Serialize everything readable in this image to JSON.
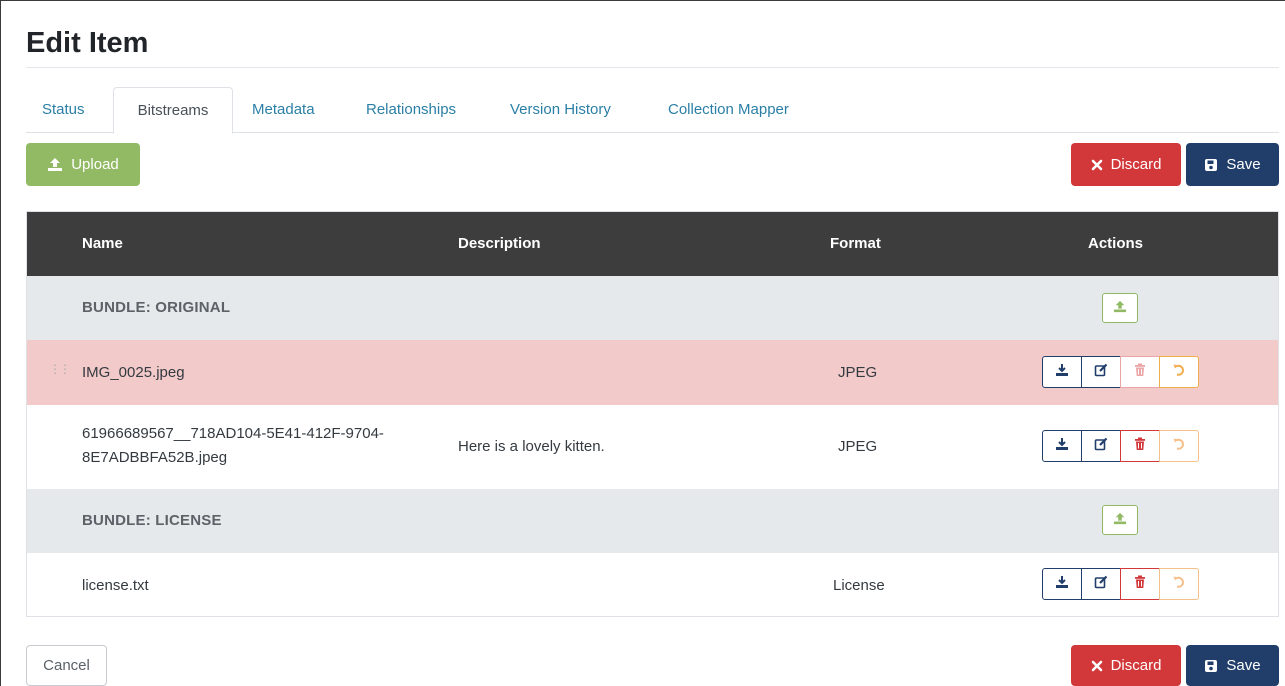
{
  "page": {
    "title": "Edit Item"
  },
  "tabs": [
    {
      "label": "Status"
    },
    {
      "label": "Bitstreams"
    },
    {
      "label": "Metadata"
    },
    {
      "label": "Relationships"
    },
    {
      "label": "Version History"
    },
    {
      "label": "Collection Mapper"
    }
  ],
  "active_tab": "Bitstreams",
  "toolbar": {
    "upload_label": "Upload",
    "discard_label": "Discard",
    "save_label": "Save"
  },
  "footer": {
    "cancel_label": "Cancel",
    "discard_label": "Discard",
    "save_label": "Save"
  },
  "table": {
    "headers": {
      "name": "Name",
      "description": "Description",
      "format": "Format",
      "actions": "Actions"
    },
    "bundles": [
      {
        "label": "BUNDLE: ORIGINAL",
        "files": [
          {
            "name": "IMG_0025.jpeg",
            "description": "",
            "format": "JPEG",
            "state": "deleted"
          },
          {
            "name_line1": "61966689567__718AD104-5E41-412F-9704-",
            "name_line2": "8E7ADBBFA52B.jpeg",
            "description": "Here is a lovely kitten.",
            "format": "JPEG",
            "state": "normal"
          }
        ]
      },
      {
        "label": "BUNDLE: LICENSE",
        "files": [
          {
            "name": "license.txt",
            "description": "",
            "format": "License",
            "state": "normal"
          }
        ]
      }
    ]
  },
  "icons": {
    "upload": "upload-icon",
    "discard": "times-icon",
    "save": "floppy-disk-icon",
    "drag": "drag-handle-icon",
    "download": "download-icon",
    "edit": "edit-icon",
    "delete": "trash-icon",
    "undo": "undo-icon"
  },
  "colors": {
    "upload": "#92b964",
    "discard": "#d2373a",
    "save": "#213e6b",
    "table_header": "#3d3d3d",
    "bundle_row": "#e5e9ec",
    "deleted_row": "#f2caca",
    "link": "#2b7fa6",
    "undo": "#f0ad4e"
  }
}
